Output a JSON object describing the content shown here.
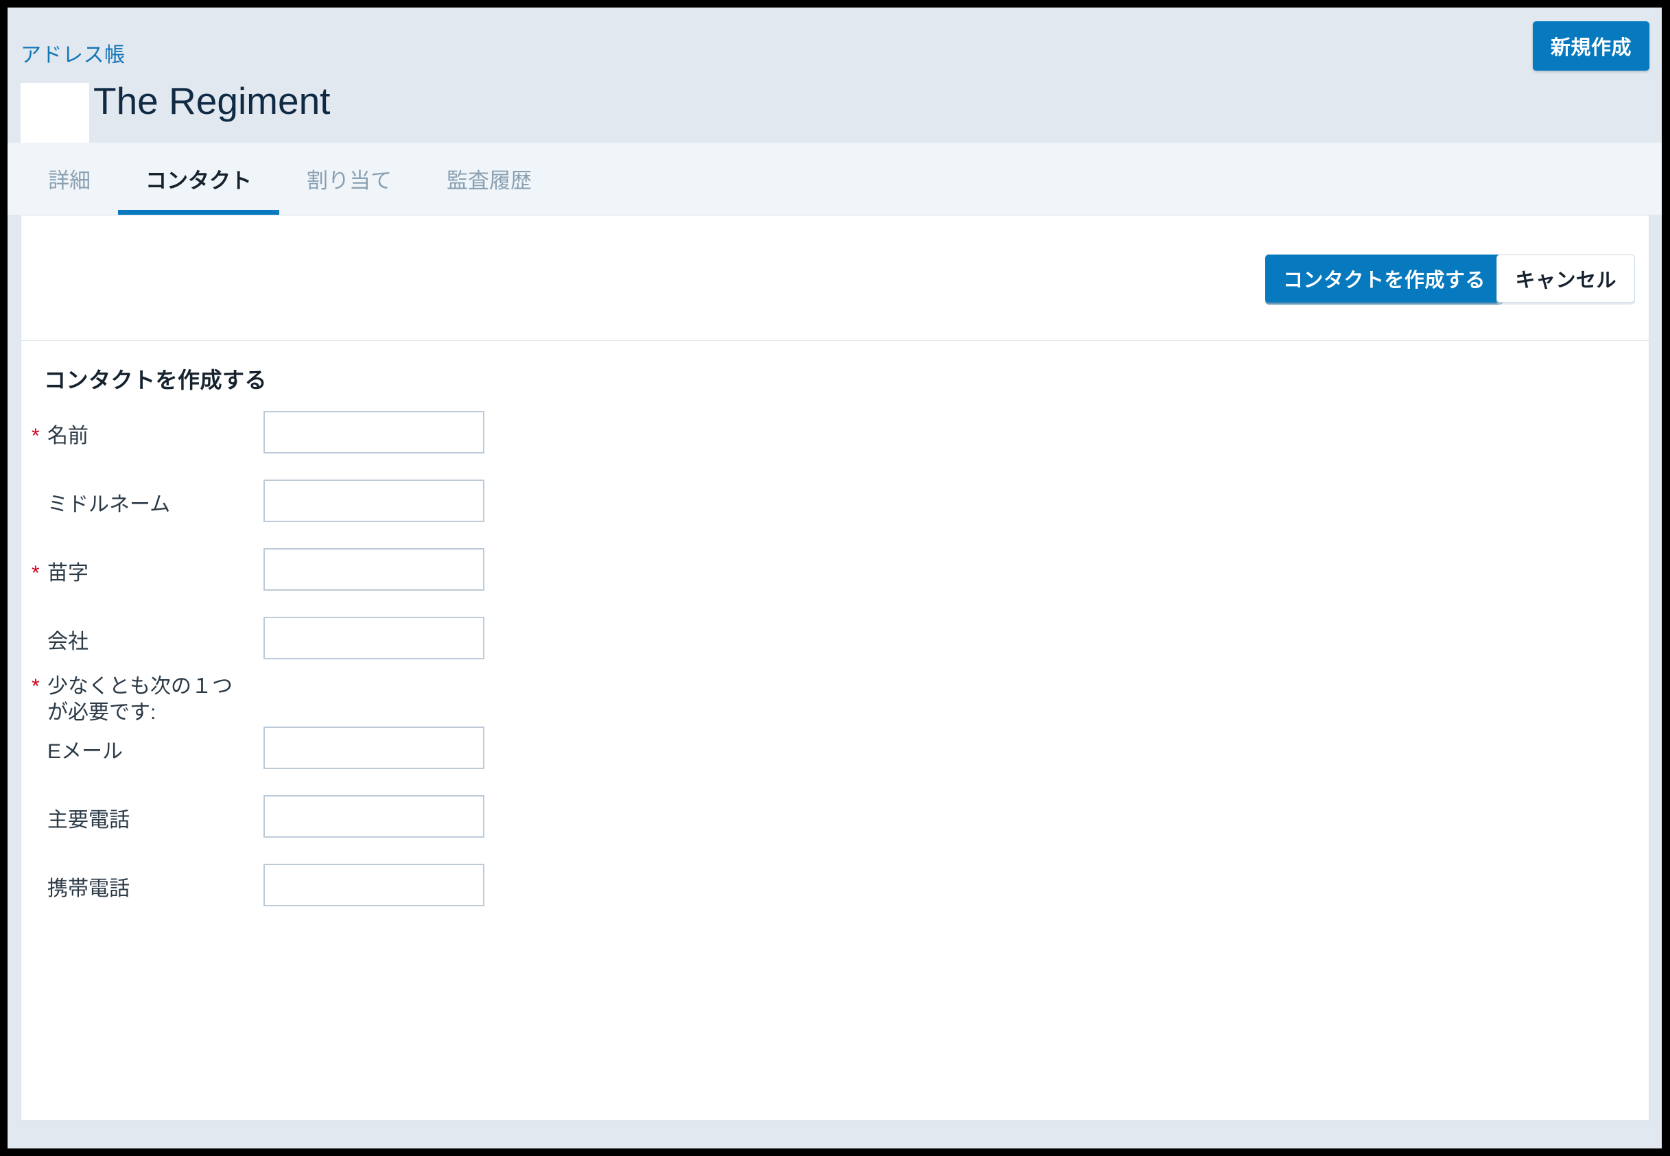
{
  "colors": {
    "accent_blue": "#0779be",
    "link_blue": "#1377b8",
    "header_band": "#e2e8f0",
    "tabs_band": "#f0f5f9",
    "card_white": "#ffffff",
    "required_red": "#d0021b",
    "title_navy": "#102a43",
    "input_border": "#bdcbd8"
  },
  "header": {
    "breadcrumb": "アドレス帳",
    "record_title": "The Regiment",
    "new_button_label": "新規作成",
    "logo_alt": "logo-placeholder"
  },
  "tabs": [
    {
      "label": "詳細",
      "active": false
    },
    {
      "label": "コンタクト",
      "active": true
    },
    {
      "label": "割り当て",
      "active": false
    },
    {
      "label": "監査履歴",
      "active": false
    }
  ],
  "action_bar": {
    "primary_label": "コンタクトを作成する",
    "cancel_label": "キャンセル"
  },
  "form": {
    "heading": "コンタクトを作成する",
    "required_marker": "*",
    "fields": [
      {
        "id": "firstname",
        "label": "名前",
        "required": true,
        "value": "",
        "placeholder": "",
        "has_input": true
      },
      {
        "id": "middlename",
        "label": "ミドルネーム",
        "required": false,
        "value": "",
        "placeholder": "",
        "has_input": true
      },
      {
        "id": "lastname",
        "label": "苗字",
        "required": true,
        "value": "",
        "placeholder": "",
        "has_input": true
      },
      {
        "id": "company",
        "label": "会社",
        "required": false,
        "value": "",
        "placeholder": "",
        "has_input": true
      },
      {
        "id": "atleast",
        "label": "少なくとも次の１つが必要です:",
        "required": true,
        "has_input": false
      },
      {
        "id": "email",
        "label": "Eメール",
        "required": false,
        "value": "",
        "placeholder": "",
        "has_input": true
      },
      {
        "id": "phone",
        "label": "主要電話",
        "required": false,
        "value": "",
        "placeholder": "",
        "has_input": true
      },
      {
        "id": "mobile",
        "label": "携帯電話",
        "required": false,
        "value": "",
        "placeholder": "",
        "has_input": true
      }
    ]
  }
}
